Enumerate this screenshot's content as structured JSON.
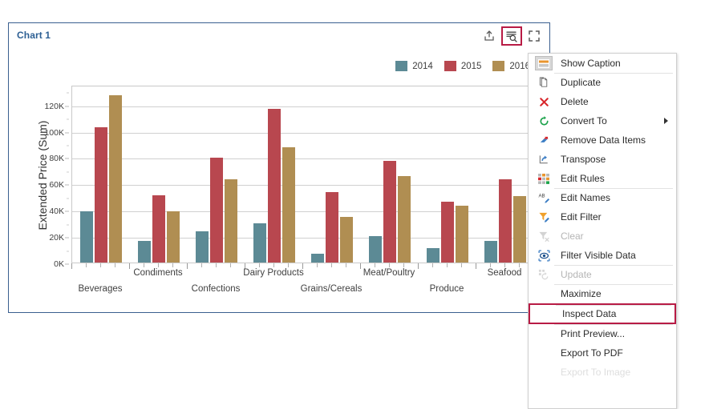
{
  "panel": {
    "title": "Chart 1",
    "tools": [
      {
        "name": "export-icon",
        "label": "Export",
        "active": false
      },
      {
        "name": "inspect-data-icon",
        "label": "Inspect Data",
        "active": true
      },
      {
        "name": "maximize-icon",
        "label": "Maximize",
        "active": false
      }
    ],
    "accent_border": "#3a5f8f",
    "title_color": "#2e6094",
    "highlight_color": "#b81b45"
  },
  "chart_data": {
    "type": "bar",
    "title": "",
    "xlabel": "",
    "ylabel": "Extended Price (Sum)",
    "ylim": [
      0,
      135000
    ],
    "ytick_labels": [
      "0K",
      "20K",
      "40K",
      "60K",
      "80K",
      "100K",
      "120K"
    ],
    "ytick_values": [
      0,
      20000,
      40000,
      60000,
      80000,
      100000,
      120000
    ],
    "grid": true,
    "legend_position": "top-right",
    "categories": [
      "Beverages",
      "Condiments",
      "Confections",
      "Dairy Products",
      "Grains/Cereals",
      "Meat/Poultry",
      "Produce",
      "Seafood"
    ],
    "series": [
      {
        "name": "2014",
        "color": "#5c8a95",
        "values": [
          39000,
          16500,
          24000,
          30000,
          7000,
          20000,
          11000,
          16500
        ]
      },
      {
        "name": "2015",
        "color": "#b8474f",
        "values": [
          103000,
          51000,
          79500,
          116500,
          53500,
          77000,
          46000,
          63500
        ]
      },
      {
        "name": "2016",
        "color": "#b08e52",
        "values": [
          127000,
          39000,
          63000,
          87500,
          34500,
          65500,
          43000,
          50500
        ]
      }
    ]
  },
  "context_menu": {
    "items": [
      {
        "label": "Show Caption",
        "icon": "caption-icon",
        "state": "normal",
        "separator": false,
        "submenu": false
      },
      {
        "label": "Duplicate",
        "icon": "duplicate-icon",
        "state": "normal",
        "separator": true,
        "submenu": false
      },
      {
        "label": "Delete",
        "icon": "delete-icon",
        "state": "normal",
        "separator": false,
        "submenu": false
      },
      {
        "label": "Convert To",
        "icon": "convert-icon",
        "state": "normal",
        "separator": false,
        "submenu": true
      },
      {
        "label": "Remove Data Items",
        "icon": "remove-data-items-icon",
        "state": "normal",
        "separator": false,
        "submenu": false
      },
      {
        "label": "Transpose",
        "icon": "transpose-icon",
        "state": "normal",
        "separator": false,
        "submenu": false
      },
      {
        "label": "Edit Rules",
        "icon": "edit-rules-icon",
        "state": "normal",
        "separator": false,
        "submenu": false
      },
      {
        "label": "Edit Names",
        "icon": "edit-names-icon",
        "state": "normal",
        "separator": true,
        "submenu": false
      },
      {
        "label": "Edit Filter",
        "icon": "edit-filter-icon",
        "state": "normal",
        "separator": false,
        "submenu": false
      },
      {
        "label": "Clear",
        "icon": "clear-filter-icon",
        "state": "disabled",
        "separator": false,
        "submenu": false
      },
      {
        "label": "Filter Visible Data",
        "icon": "filter-visible-data-icon",
        "state": "normal",
        "separator": false,
        "submenu": false
      },
      {
        "label": "Update",
        "icon": "update-icon",
        "state": "disabled",
        "separator": true,
        "submenu": false
      },
      {
        "label": "Maximize",
        "icon": "",
        "state": "normal",
        "separator": true,
        "submenu": false
      },
      {
        "label": "Inspect Data",
        "icon": "",
        "state": "highlighted",
        "separator": true,
        "submenu": false
      },
      {
        "label": "Print Preview...",
        "icon": "",
        "state": "normal",
        "separator": true,
        "submenu": false
      },
      {
        "label": "Export To PDF",
        "icon": "",
        "state": "normal",
        "separator": false,
        "submenu": false
      },
      {
        "label": "Export To Image",
        "icon": "",
        "state": "cutoff",
        "separator": false,
        "submenu": false
      }
    ]
  }
}
